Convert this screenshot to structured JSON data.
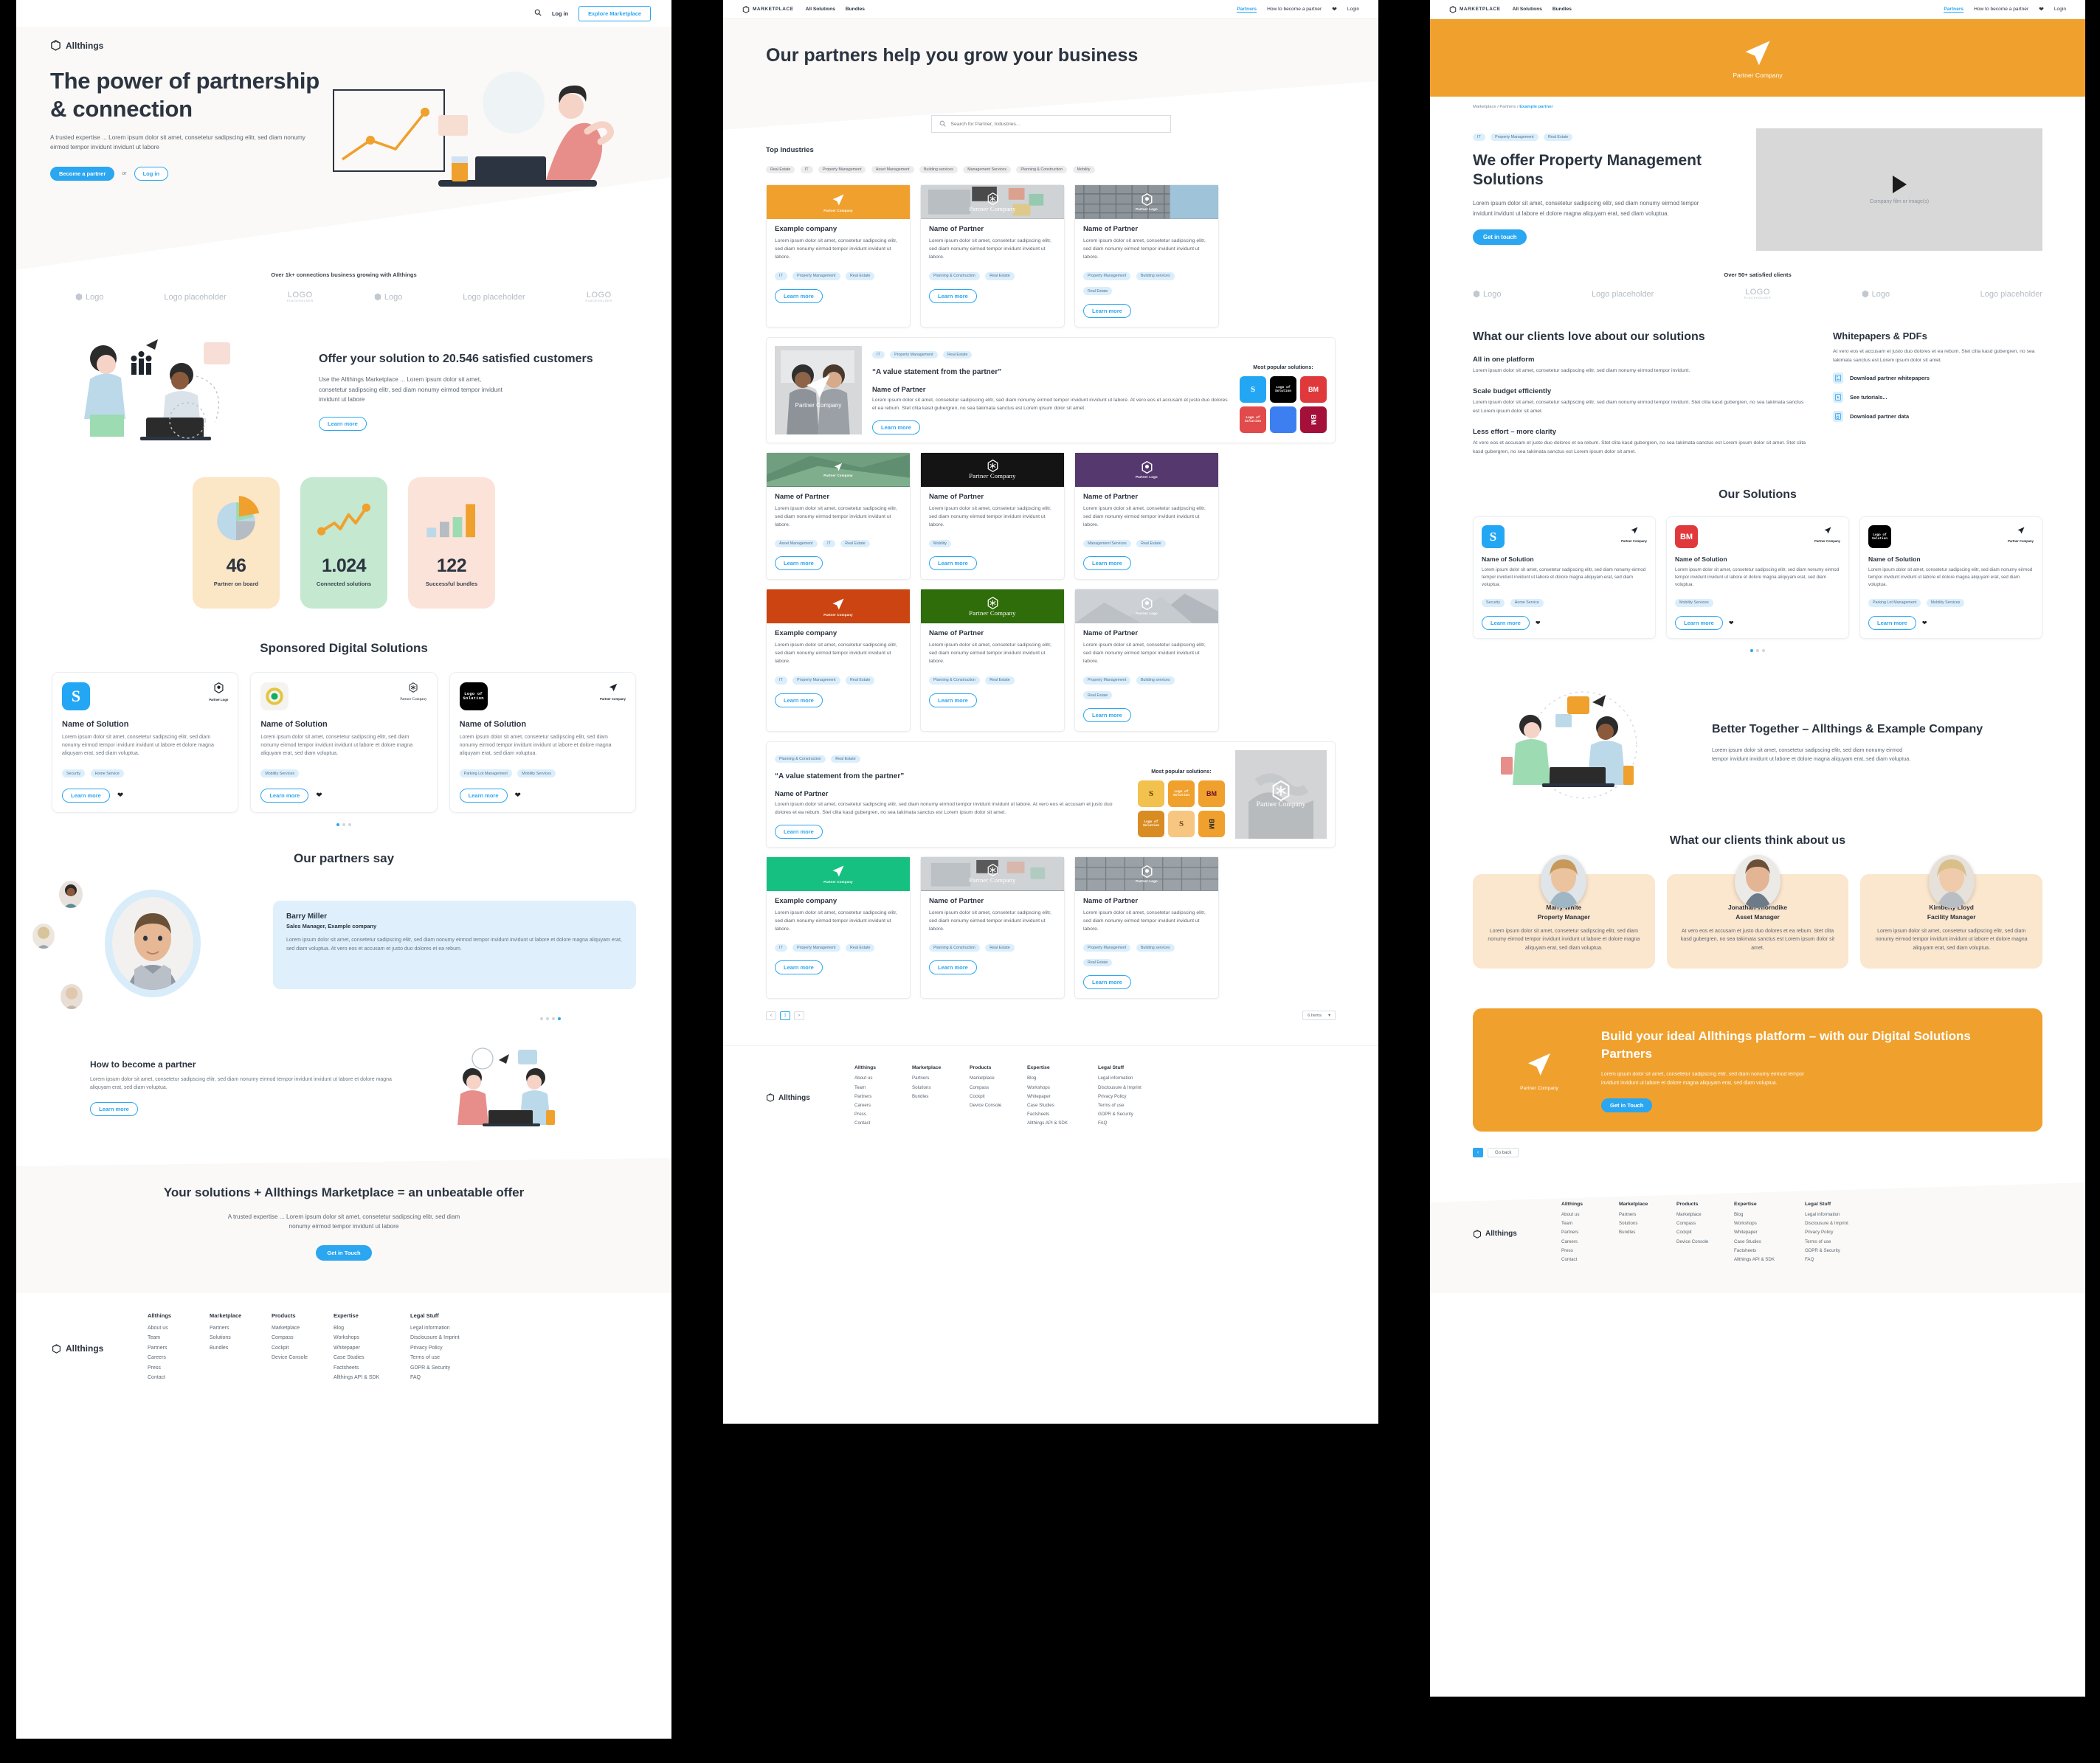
{
  "brand": {
    "name": "Allthings",
    "marketplace": "MARKETPLACE"
  },
  "colors": {
    "accent": "#2ba6f0",
    "orange": "#f0a02c",
    "cream": "#faf9f7",
    "chip": "#dbeefc"
  },
  "home": {
    "topnav": {
      "search_icon": "search-icon",
      "login": "Log in",
      "cta": "Explore Marketplace"
    },
    "hero": {
      "title": "The power of partnership & connection",
      "body": "A trusted expertise ... Lorem ipsum dolor sit amet, consetetur sadipscing elitr, sed diam nonumy eirmod tempor invidunt invidunt ut labore",
      "primary": "Become a partner",
      "or": "or",
      "secondary": "Log in"
    },
    "logos": {
      "label": "Over 1k+ connections business growing with Allthings",
      "items": [
        "Logo",
        "Logo placeholder",
        "LOGO",
        "Logo",
        "Logo placeholder",
        "LOGO"
      ],
      "placeholder_sub": "PLACEHOLDER"
    },
    "offer": {
      "title": "Offer your solution to 20.546 satisfied customers",
      "body": "Use the Allthings Marketplace ... Lorem ipsum dolor sit amet, consetetur sadipscing elitr, sed diam nonumy eirmod tempor invidunt invidunt ut labore",
      "cta": "Learn more"
    },
    "stats": [
      {
        "value": "46",
        "label": "Partner on board",
        "icon": "pie-chart-icon"
      },
      {
        "value": "1.024",
        "label": "Connected solutions",
        "icon": "line-chart-icon"
      },
      {
        "value": "122",
        "label": "Successful bundles",
        "icon": "bar-chart-icon"
      }
    ],
    "sponsored": {
      "title": "Sponsored Digital Solutions",
      "cards": [
        {
          "logo_type": "blue-s",
          "logo_text": "S",
          "partner_label": "Partner Logo",
          "partner_icon": "hexagon-icon",
          "name": "Name of Solution",
          "body": "Lorem ipsum dolor sit amet, consetetur sadipscing elitr, sed diam nonumy eirmod tempor invidunt invidunt ut labore et dolore magna aliquyam erat, sed diam voluptua.",
          "tags": [
            "Security",
            "Home Service"
          ],
          "cta": "Learn more"
        },
        {
          "logo_type": "ring",
          "logo_text": "",
          "partner_label": "Partner Company",
          "partner_icon": "cube-icon",
          "name": "Name of Solution",
          "body": "Lorem ipsum dolor sit amet, consetetur sadipscing elitr, sed diam nonumy eirmod tempor invidunt invidunt ut labore et dolore magna aliquyam erat, sed diam voluptua.",
          "tags": [
            "Mobility Services"
          ],
          "cta": "Learn more"
        },
        {
          "logo_type": "black",
          "logo_text": "Logo of Solution",
          "partner_label": "Partner Company",
          "partner_icon": "arrow-icon",
          "name": "Name of Solution",
          "body": "Lorem ipsum dolor sit amet, consetetur sadipscing elitr, sed diam nonumy eirmod tempor invidunt invidunt ut labore et dolore magna aliquyam erat, sed diam voluptua.",
          "tags": [
            "Parking Lot Management",
            "Mobility Services"
          ],
          "cta": "Learn more"
        }
      ]
    },
    "testimonials": {
      "title": "Our partners say",
      "name": "Barry Miller",
      "role": "Sales Manager, Example company",
      "body": "Lorem ipsum dolor sit amet, consetetur sadipscing elitr, sed diam nonumy eirmod tempor invidunt invidunt ut labore et dolore magna aliquyam erat, sed diam voluptua. At vero eos et accusam et justo duo dolores et ea rebum."
    },
    "become": {
      "title": "How to become a partner",
      "body": "Lorem ipsum dolor sit amet, consetetur sadipscing elitr, sed diam nonumy eirmod tempor invidunt invidunt ut labore et dolore magna aliquyam erat, sed diam voluptua.",
      "cta": "Learn more"
    },
    "cta": {
      "title": "Your solutions + Allthings Marketplace = an unbeatable offer",
      "body": "A trusted expertise ... Lorem ipsum dolor sit amet, consetetur sadipscing elitr, sed diam nonumy eirmod tempor invidunt ut labore",
      "button": "Get in Touch"
    }
  },
  "footer": {
    "brand": "Allthings",
    "columns": [
      {
        "title": "Allthings",
        "links": [
          "About us",
          "Team",
          "Partners",
          "Careers",
          "Press",
          "Contact"
        ]
      },
      {
        "title": "Marketplace",
        "links": [
          "Partners",
          "Solutions",
          "Bundles"
        ]
      },
      {
        "title": "Products",
        "links": [
          "Marketplace",
          "Compass",
          "Cockpit",
          "Device Console"
        ]
      },
      {
        "title": "Expertise",
        "links": [
          "Blog",
          "Workshops",
          "Whitepaper",
          "Case Studies",
          "Factsheets",
          "Allthings API & SDK"
        ]
      },
      {
        "title": "Legal Stuff",
        "links": [
          "Legal information",
          "Disclousure & Imprint",
          "Privacy Policy",
          "Terms of use",
          "GDPR & Security",
          "FAQ"
        ]
      }
    ]
  },
  "marketplace_nav": {
    "logo": "MARKETPLACE",
    "links": [
      "All Solutions",
      "Bundles"
    ],
    "right": [
      "Partners",
      "How to become a partner"
    ],
    "heart_icon": "heart-icon",
    "login": "Login"
  },
  "partners": {
    "hero_title": "Our partners help you grow your business",
    "search_placeholder": "Search for Partner, Industries...",
    "search_icon": "search-icon",
    "top_industries_title": "Top Industries",
    "industries": [
      "Real Estate",
      "IT",
      "Property Management",
      "Asset Management",
      "Building services",
      "Management Services",
      "Planning & Construction",
      "Mobility"
    ],
    "cards": [
      {
        "name": "Example company",
        "banner": "orange-arrow",
        "banner_label": "Partner Company",
        "body": "Lorem ipsum dolor sit amet, consetetur sadipscing elitr, sed diam nonumy eirmod tempor invidunt invidunt ut labore.",
        "tags": [
          "IT",
          "Property Management",
          "Real Estate"
        ],
        "cta": "Learn more"
      },
      {
        "name": "Name of Partner",
        "banner": "photo-desk",
        "banner_label": "Partner Company",
        "body": "Lorem ipsum dolor sit amet, consetetur sadipscing elitr, sed diam nonumy eirmod tempor invidunt invidunt ut labore.",
        "tags": [
          "Planning & Construction",
          "Real Estate"
        ],
        "cta": "Learn more"
      },
      {
        "name": "Name of Partner",
        "banner": "photo-building",
        "banner_label": "Partner Logo",
        "body": "Lorem ipsum dolor sit amet, consetetur sadipscing elitr, sed diam nonumy eirmod tempor invidunt invidunt ut labore.",
        "tags": [
          "Property Management",
          "Building services",
          "Real Estate"
        ],
        "cta": "Learn more"
      },
      {
        "name": "Name of Partner",
        "banner": "photo-green",
        "banner_label": "Partner Company",
        "body": "Lorem ipsum dolor sit amet, consetetur sadipscing elitr, sed diam nonumy eirmod tempor invidunt invidunt ut labore.",
        "tags": [
          "Asset Management",
          "IT",
          "Real Estate"
        ],
        "cta": "Learn more"
      },
      {
        "name": "Name of Partner",
        "banner": "black-cube",
        "banner_label": "Partner Company",
        "body": "Lorem ipsum dolor sit amet, consetetur sadipscing elitr, sed diam nonumy eirmod tempor invidunt invidunt ut labore.",
        "tags": [
          "Mobility"
        ],
        "cta": "Learn more"
      },
      {
        "name": "Name of Partner",
        "banner": "purple-hex",
        "banner_label": "Partner Logo",
        "body": "Lorem ipsum dolor sit amet, consetetur sadipscing elitr, sed diam nonumy eirmod tempor invidunt invidunt ut labore.",
        "tags": [
          "Management Services",
          "Real Estate"
        ],
        "cta": "Learn more"
      },
      {
        "name": "Example company",
        "banner": "red-arrow",
        "banner_label": "Partner Company",
        "body": "Lorem ipsum dolor sit amet, consetetur sadipscing elitr, sed diam nonumy eirmod tempor invidunt invidunt ut labore.",
        "tags": [
          "IT",
          "Property Management",
          "Real Estate"
        ],
        "cta": "Learn more"
      },
      {
        "name": "Name of Partner",
        "banner": "green-cube",
        "banner_label": "Partner Company",
        "body": "Lorem ipsum dolor sit amet, consetetur sadipscing elitr, sed diam nonumy eirmod tempor invidunt invidunt ut labore.",
        "tags": [
          "Planning & Construction",
          "Real Estate"
        ],
        "cta": "Learn more"
      },
      {
        "name": "Name of Partner",
        "banner": "grey-hex",
        "banner_label": "Partner Logo",
        "body": "Lorem ipsum dolor sit amet, consetetur sadipscing elitr, sed diam nonumy eirmod tempor invidunt invidunt ut labore.",
        "tags": [
          "Property Management",
          "Building services",
          "Real Estate"
        ],
        "cta": "Learn more"
      },
      {
        "name": "Example company",
        "banner": "green-arrow",
        "banner_label": "Partner Company",
        "body": "Lorem ipsum dolor sit amet, consetetur sadipscing elitr, sed diam nonumy eirmod tempor invidunt invidunt ut labore.",
        "tags": [
          "IT",
          "Property Management",
          "Real Estate"
        ],
        "cta": "Learn more"
      },
      {
        "name": "Name of Partner",
        "banner": "photo-desk2",
        "banner_label": "Partner Company",
        "body": "Lorem ipsum dolor sit amet, consetetur sadipscing elitr, sed diam nonumy eirmod tempor invidunt invidunt ut labore.",
        "tags": [
          "Planning & Construction",
          "Real Estate"
        ],
        "cta": "Learn more"
      },
      {
        "name": "Name of Partner",
        "banner": "photo-building2",
        "banner_label": "Partner Logo",
        "body": "Lorem ipsum dolor sit amet, consetetur sadipscing elitr, sed diam nonumy eirmod tempor invidunt invidunt ut labore.",
        "tags": [
          "Property Management",
          "Building services",
          "Real Estate"
        ],
        "cta": "Learn more"
      }
    ],
    "feature_one": {
      "tags": [
        "IT",
        "Property Management",
        "Real Estate"
      ],
      "quote": "“A value statement from the partner”",
      "name": "Name of Partner",
      "body": "Lorem ipsum dolor sit amet, consetetur sadipscing elitr, sed diam nonumy eirmod tempor invidunt invidunt ut labore.  At vero eos et accusam et justo duo dolores et ea rebum. Stet clita kasd gubergren, no sea takimata sanctus est Lorem ipsum dolor sit amet.",
      "cta": "Learn more",
      "popular_title": "Most popular solutions:",
      "image_label": "Partner Company",
      "solutions": [
        "S",
        "Logo of Solution",
        "BM",
        "Logo of Solution",
        "",
        "BM"
      ]
    },
    "feature_two": {
      "tags": [
        "Planning & Construction",
        "Real Estate"
      ],
      "quote": "“A value statement from the partner”",
      "name": "Name of Partner",
      "body": "Lorem ipsum dolor sit amet, consetetur sadipscing elitr, sed diam nonumy eirmod tempor invidunt invidunt ut labore.  At vero eos et accusam et justo duo dolores et ea rebum. Stet clita kasd gubergren, no sea takimata sanctus est Lorem ipsum dolor sit amet.",
      "cta": "Learn more",
      "popular_title": "Most popular solutions:",
      "image_label": "Partner Company",
      "solutions": [
        "S",
        "Logo of Solution",
        "BM",
        "Logo of Solution",
        "S",
        "BM"
      ]
    },
    "pager": {
      "prev": "‹",
      "current": "1",
      "next": "›",
      "per_page": "6 Items"
    }
  },
  "detail": {
    "hero_label": "Partner Company",
    "breadcrumb": {
      "a": "Marketplace",
      "b": "Partners",
      "c": "Example partner"
    },
    "tags": [
      "IT",
      "Property Management",
      "Real Estate"
    ],
    "title": "We offer Property Management Solutions",
    "body": "Lorem ipsum dolor sit amet, consetetur sadipscing elitr, sed diam nonumy eirmod tempor invidunt invidunt ut labore et dolore magna aliquyam erat, sed diam voluptua.",
    "cta": "Get in touch",
    "video_caption": "Company film or image(s)",
    "clients_label": "Over 50+ satisfied clients",
    "client_logos": [
      "Logo",
      "Logo placeholder",
      "LOGO",
      "Logo",
      "Logo placeholder"
    ],
    "love": {
      "title": "What our clients love about our solutions",
      "items": [
        {
          "h": "All in one platform",
          "p": "Lorem ipsum dolor sit amet, consetetur sadipscing elitr, sed diam nonumy eirmod tempor invidunt."
        },
        {
          "h": "Scale budget efficiently",
          "p": "Lorem ipsum dolor sit amet, consetetur sadipscing elitr, sed diam nonumy eirmod tempor invidunt. Stet clita kasd gubergren, no sea takimata sanctus est Lorem ipsum dolor sit amet."
        },
        {
          "h": "Less effort – more clarity",
          "p": "At vero eos et accusam et justo duo dolores et ea rebum. Stet clita kasd gubergren, no sea takimata sanctus est Lorem ipsum dolor sit amet. Stet clita kasd gubergren, no sea takimata sanctus est Lorem ipsum dolor sit amet."
        }
      ]
    },
    "whitepapers": {
      "title": "Whitepapers & PDFs",
      "body": "At vero eos et accusam et justo duo dolores et ea rebum. Stet clita kasd gubergren, no sea takimata sanctus est Lorem ipsum dolor sit amet.",
      "links": [
        {
          "label": "Download partner whitepapers",
          "icon": "document-icon"
        },
        {
          "label": "See tutorials...",
          "icon": "video-icon"
        },
        {
          "label": "Download partner data",
          "icon": "data-icon"
        }
      ]
    },
    "our_solutions": {
      "title": "Our Solutions",
      "cards": [
        {
          "logo_type": "blue-s",
          "logo_text": "S",
          "partner_label": "Partner Company",
          "name": "Name of Solution",
          "body": "Lorem ipsum dolor sit amet, consetetur sadipscing elitr, sed diam nonumy eirmod tempor invidunt invidunt ut labore et dolore magna aliquyam erat, sed diam voluptua.",
          "tags": [
            "Security",
            "Home Service"
          ],
          "cta": "Learn more"
        },
        {
          "logo_type": "red-bm",
          "logo_text": "BM",
          "partner_label": "Partner Company",
          "name": "Name of Solution",
          "body": "Lorem ipsum dolor sit amet, consetetur sadipscing elitr, sed diam nonumy eirmod tempor invidunt invidunt ut labore et dolore magna aliquyam erat, sed diam voluptua.",
          "tags": [
            "Mobility Services"
          ],
          "cta": "Learn more"
        },
        {
          "logo_type": "black",
          "logo_text": "Logo of Solution",
          "partner_label": "Partner Company",
          "name": "Name of Solution",
          "body": "Lorem ipsum dolor sit amet, consetetur sadipscing elitr, sed diam nonumy eirmod tempor invidunt invidunt ut labore et dolore magna aliquyam erat, sed diam voluptua.",
          "tags": [
            "Parking Lot Management",
            "Mobility Services"
          ],
          "cta": "Learn more"
        }
      ]
    },
    "better": {
      "title": "Better Together – Allthings & Example Company",
      "body": "Lorem ipsum dolor sit amet, consetetur sadipscing elitr, sed diam nonumy eirmod tempor invidunt invidunt ut labore et dolore magna aliquyam erat, sed diam voluptua."
    },
    "think": {
      "title": "What our clients think about us",
      "cards": [
        {
          "name": "Marry White",
          "role": "Property Manager",
          "body": "Lorem ipsum dolor sit amet, consetetur sadipscing elitr, sed diam nonumy eirmod tempor invidunt invidunt ut labore et dolore magna aliquyam erat, sed diam voluptua."
        },
        {
          "name": "Jonathan Thorndike",
          "role": "Asset Manager",
          "body": "At vero eos et accusam et justo duo dolores et ea rebum. Stet clita kasd gubergren, no sea takimata sanctus est Lorem ipsum dolor sit amet."
        },
        {
          "name": "Kimberly Lloyd",
          "role": "Facility Manager",
          "body": "Lorem ipsum dolor sit amet, consetetur sadipscing elitr, sed diam nonumy eirmod tempor invidunt invidunt ut labore et dolore magna aliquyam erat, sed diam voluptua."
        }
      ]
    },
    "build": {
      "logo_label": "Partner Company",
      "title": "Build your ideal Allthings platform – with our Digital Solutions Partners",
      "body": "Lorem ipsum dolor sit amet, consetetur sadipscing elitr, sed diam nonumy eirmod tempor invidunt invidunt ut labore et dolore magna aliquyam erat, sed diam voluptua.",
      "cta": "Get in Touch"
    },
    "go_back": {
      "arrow": "‹",
      "label": "Go back"
    }
  }
}
